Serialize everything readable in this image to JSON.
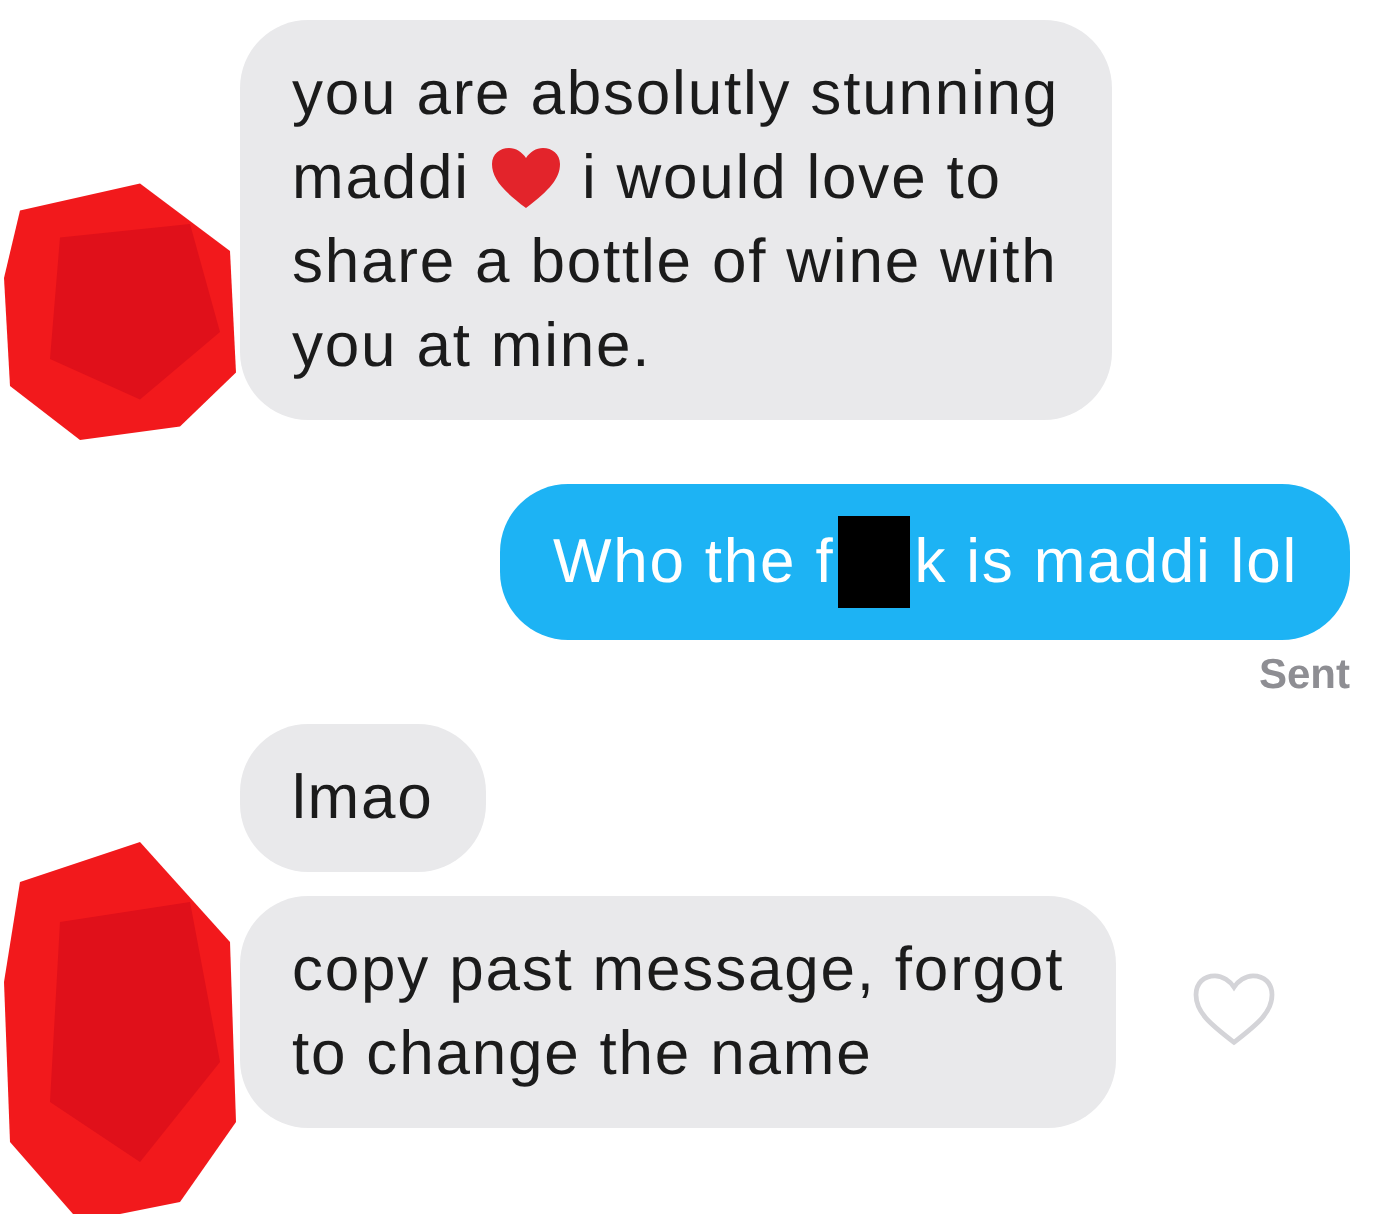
{
  "messages": [
    {
      "kind": "received",
      "avatar_redacted": true,
      "lines": [
        [
          {
            "kind": "text",
            "text": "you are absolutly stunning"
          }
        ],
        [
          {
            "kind": "text",
            "text": "maddi"
          },
          {
            "kind": "heart"
          },
          {
            "kind": "text",
            "text": "i would love to"
          }
        ],
        [
          {
            "kind": "text",
            "text": "share a bottle of wine with"
          }
        ],
        [
          {
            "kind": "text",
            "text": "you at mine."
          }
        ]
      ]
    },
    {
      "kind": "sent",
      "status": "Sent",
      "lines": [
        [
          {
            "kind": "text",
            "text": "Who the f"
          },
          {
            "kind": "redacted"
          },
          {
            "kind": "text",
            "text": "k is maddi lol"
          }
        ]
      ]
    },
    {
      "kind": "received",
      "avatar_redacted": false,
      "lines": [
        [
          {
            "kind": "text",
            "text": "lmao"
          }
        ]
      ]
    },
    {
      "kind": "received",
      "avatar_redacted": true,
      "liked": false,
      "lines": [
        [
          {
            "kind": "text",
            "text": "copy past message, forgot"
          }
        ],
        [
          {
            "kind": "text",
            "text": "to change the name"
          }
        ]
      ]
    }
  ]
}
